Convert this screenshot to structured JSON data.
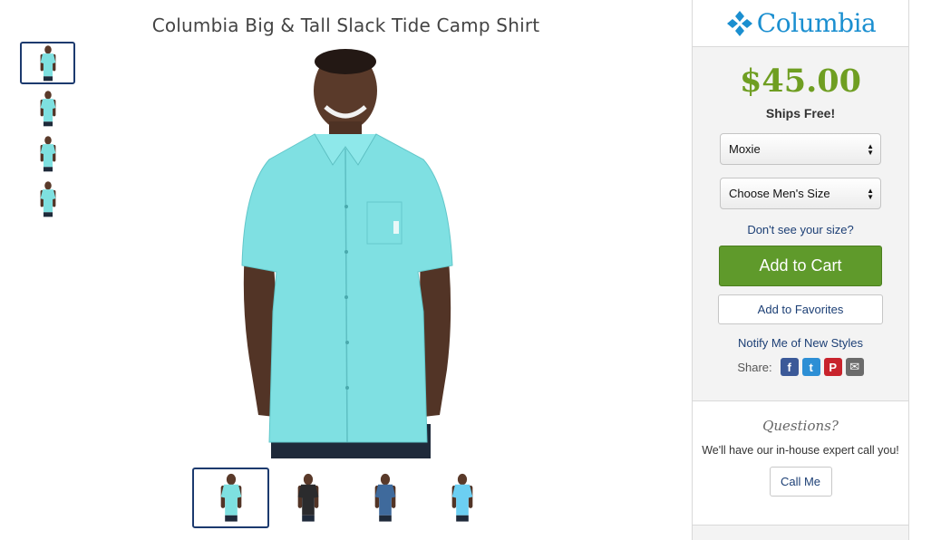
{
  "product": {
    "title": "Columbia Big & Tall Slack Tide Camp Shirt"
  },
  "gallery": {
    "thumbnails": [
      {
        "shirt_color": "#7ee0e0",
        "selected": true
      },
      {
        "shirt_color": "#7ee0e0",
        "selected": false
      },
      {
        "shirt_color": "#7ee0e0",
        "selected": false
      },
      {
        "shirt_color": "#7ee0e0",
        "selected": false
      }
    ],
    "main_shirt_color": "#7fe0e2",
    "color_options": [
      {
        "shirt_color": "#7ee0e0",
        "selected": true
      },
      {
        "shirt_color": "#2b2b2d",
        "selected": false
      },
      {
        "shirt_color": "#3f6a9c",
        "selected": false
      },
      {
        "shirt_color": "#6ccff2",
        "selected": false
      }
    ]
  },
  "sidebar": {
    "brand": "Columbia",
    "brand_color": "#1b8fd0",
    "price": "$45.00",
    "price_color": "#6f9e22",
    "shipping": "Ships Free!",
    "color_select": "Moxie",
    "size_select": "Choose Men's Size",
    "size_link": "Don't see your size?",
    "add_to_cart": "Add to Cart",
    "add_to_cart_color": "#5f9a2b",
    "add_to_favorites": "Add to Favorites",
    "notify": "Notify Me of New Styles",
    "share_label": "Share:",
    "share_icons": [
      {
        "name": "facebook-icon",
        "glyph": "f",
        "color": "#3b5998"
      },
      {
        "name": "twitter-icon",
        "glyph": "t",
        "color": "#2d8fd5"
      },
      {
        "name": "pinterest-icon",
        "glyph": "P",
        "color": "#c8232c"
      },
      {
        "name": "email-icon",
        "glyph": "✉",
        "color": "#6b6b6b"
      }
    ]
  },
  "questions": {
    "title": "Questions?",
    "text": "We'll have our in-house expert call you!",
    "button": "Call Me"
  }
}
